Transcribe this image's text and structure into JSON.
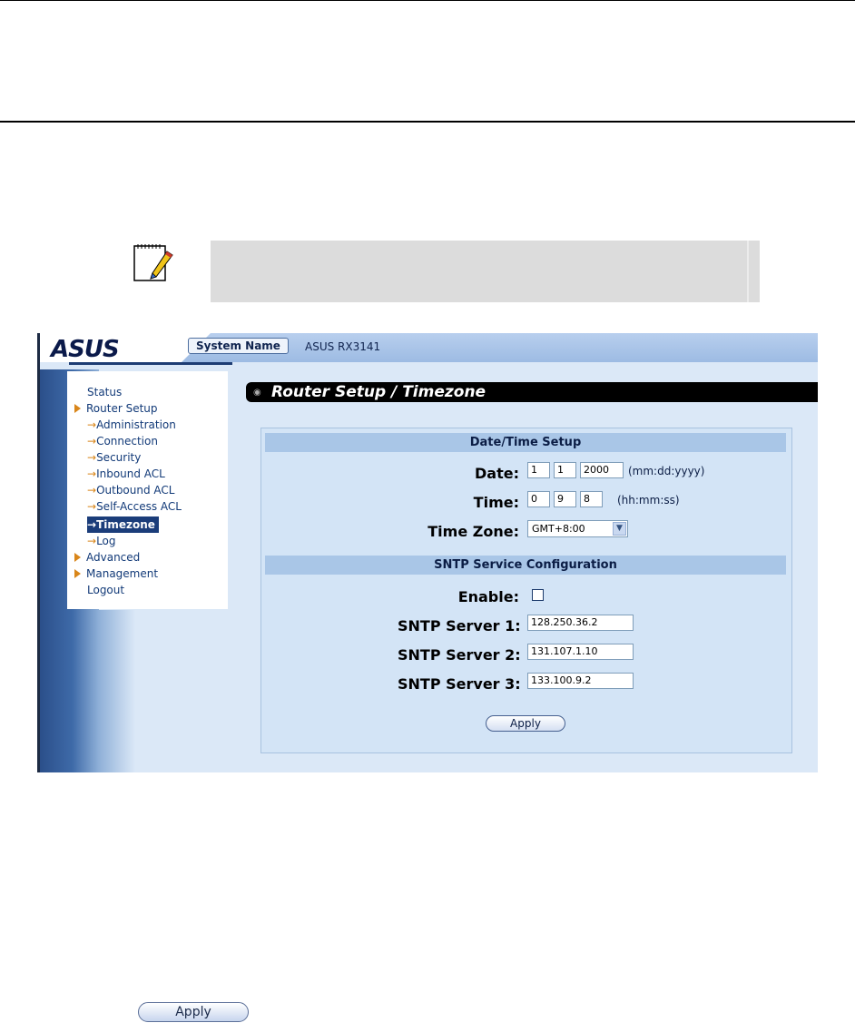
{
  "ui": {
    "logo_text": "ASUS",
    "system_name_label": "System Name",
    "system_name_value": "ASUS RX3141",
    "menu": [
      {
        "label": "Status",
        "kind": "plain"
      },
      {
        "label": "Router Setup",
        "kind": "group"
      },
      {
        "label": "Administration",
        "kind": "sub"
      },
      {
        "label": "Connection",
        "kind": "sub"
      },
      {
        "label": "Security",
        "kind": "sub"
      },
      {
        "label": "Inbound ACL",
        "kind": "sub"
      },
      {
        "label": "Outbound ACL",
        "kind": "sub"
      },
      {
        "label": "Self-Access ACL",
        "kind": "sub"
      },
      {
        "label": "Timezone",
        "kind": "active"
      },
      {
        "label": "Log",
        "kind": "sub"
      },
      {
        "label": "Advanced",
        "kind": "group"
      },
      {
        "label": "Management",
        "kind": "group"
      },
      {
        "label": "Logout",
        "kind": "plain"
      }
    ],
    "page_title": "Router Setup / Timezone",
    "datetime": {
      "heading": "Date/Time Setup",
      "date_label": "Date:",
      "date_month": "1",
      "date_day": "1",
      "date_year": "2000",
      "date_hint": "(mm:dd:yyyy)",
      "time_label": "Time:",
      "time_hour": "0",
      "time_minute": "9",
      "time_second": "8",
      "time_hint": "(hh:mm:ss)",
      "tz_label": "Time Zone:",
      "tz_value": "GMT+8:00"
    },
    "sntp": {
      "heading": "SNTP Service Configuration",
      "enable_label": "Enable:",
      "enable_checked": false,
      "server1_label": "SNTP Server 1:",
      "server1_value": "128.250.36.2",
      "server2_label": "SNTP Server 2:",
      "server2_value": "131.107.1.10",
      "server3_label": "SNTP Server 3:",
      "server3_value": "133.100.9.2"
    },
    "apply_label": "Apply"
  },
  "apply_large_label": "Apply"
}
